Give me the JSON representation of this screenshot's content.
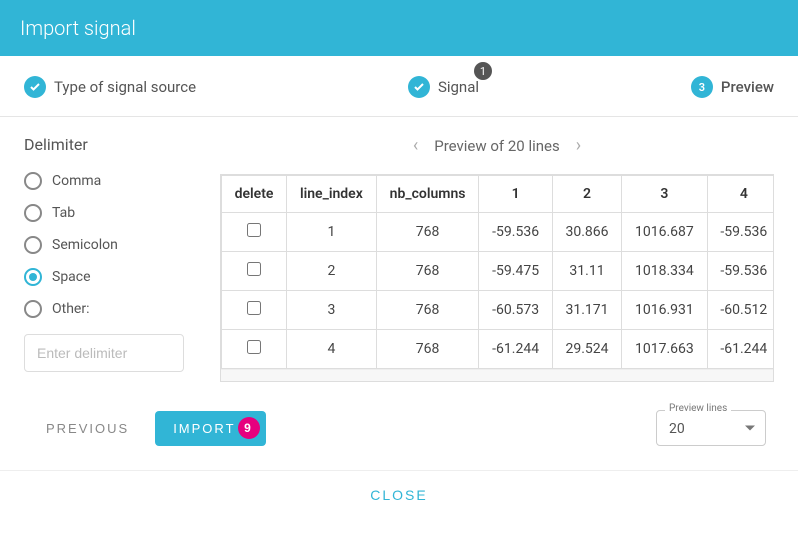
{
  "header": {
    "title": "Import signal"
  },
  "stepper": {
    "step1": {
      "label": "Type of signal source"
    },
    "step2": {
      "label": "Signal",
      "badge": "1"
    },
    "step3": {
      "num": "3",
      "label": "Preview"
    }
  },
  "delimiter": {
    "title": "Delimiter",
    "options": {
      "comma": "Comma",
      "tab": "Tab",
      "semicolon": "Semicolon",
      "space": "Space",
      "other": "Other:"
    },
    "selected": "space",
    "placeholder": "Enter delimiter"
  },
  "preview": {
    "title": "Preview of 20 lines",
    "headers": {
      "delete": "delete",
      "line_index": "line_index",
      "nb_columns": "nb_columns",
      "c1": "1",
      "c2": "2",
      "c3": "3",
      "c4": "4"
    },
    "rows": [
      {
        "line_index": "1",
        "nb_columns": "768",
        "c1": "-59.536",
        "c2": "30.866",
        "c3": "1016.687",
        "c4": "-59.536"
      },
      {
        "line_index": "2",
        "nb_columns": "768",
        "c1": "-59.475",
        "c2": "31.11",
        "c3": "1018.334",
        "c4": "-59.536"
      },
      {
        "line_index": "3",
        "nb_columns": "768",
        "c1": "-60.573",
        "c2": "31.171",
        "c3": "1016.931",
        "c4": "-60.512"
      },
      {
        "line_index": "4",
        "nb_columns": "768",
        "c1": "-61.244",
        "c2": "29.524",
        "c3": "1017.663",
        "c4": "-61.244"
      }
    ]
  },
  "footer": {
    "previous": "PREVIOUS",
    "import": "IMPORT",
    "import_badge": "9",
    "preview_lines_label": "Preview lines",
    "preview_lines_value": "20",
    "close": "CLOSE"
  }
}
